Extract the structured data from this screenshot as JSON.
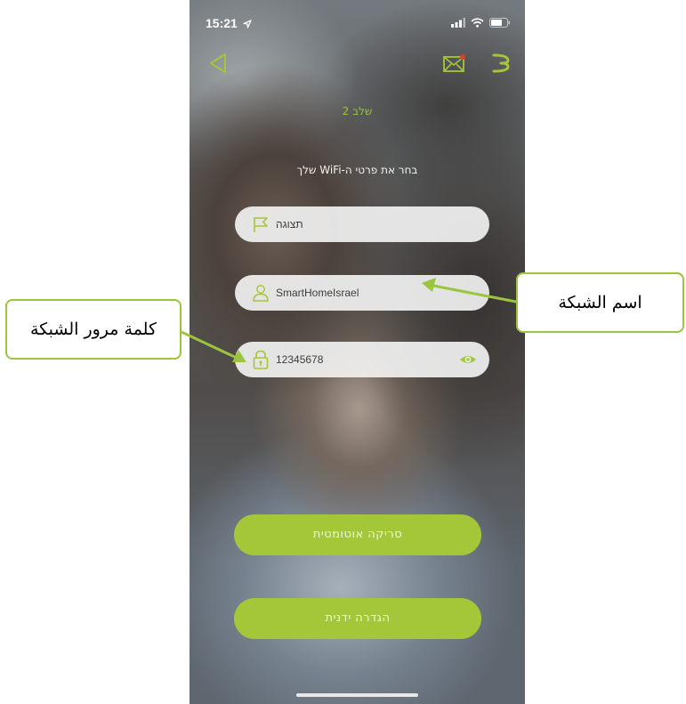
{
  "status_bar": {
    "time": "15:21"
  },
  "header": {
    "step": "שלב 2",
    "instruction": "בחר את פרטי ה-WiFi שלך"
  },
  "fields": {
    "display": {
      "value": "תצוגה",
      "icon": "flag-icon"
    },
    "network": {
      "value": "SmartHomeIsrael",
      "icon": "user-icon"
    },
    "password": {
      "value": "12345678",
      "icon": "lock-icon"
    }
  },
  "buttons": {
    "auto_scan": "סריקה אוטומטית",
    "manual_setup": "הגדרה ידנית"
  },
  "annotations": {
    "network_name": "اسم الشبكة",
    "network_password": "كلمة مرور الشبكة"
  },
  "colors": {
    "accent": "#a4c639",
    "callout_border": "#9bc53d"
  }
}
